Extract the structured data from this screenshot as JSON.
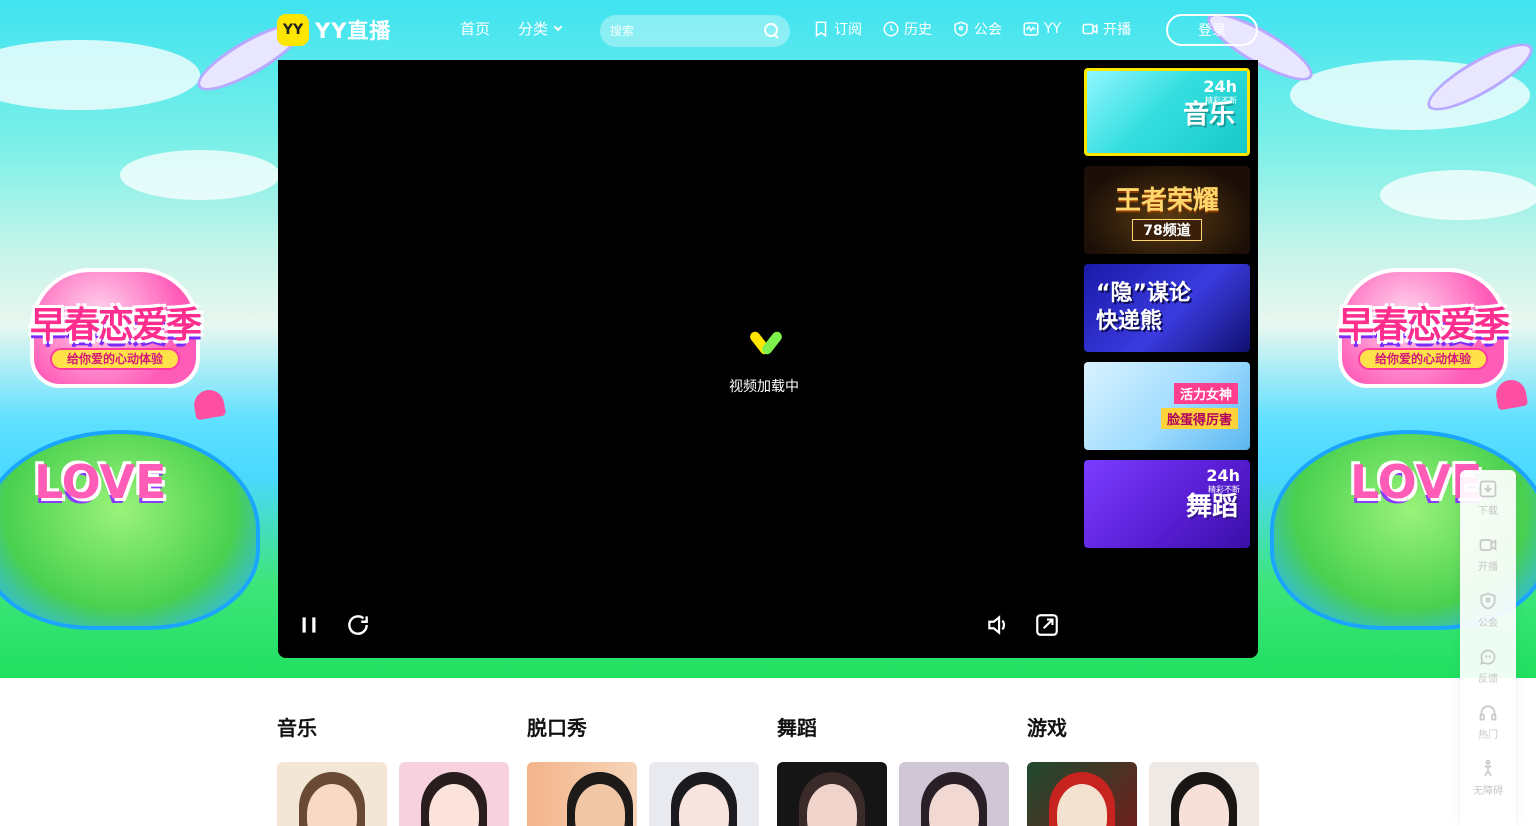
{
  "header": {
    "logo_badge": "YY",
    "logo_text": "YY直播",
    "nav": [
      {
        "label": "首页"
      },
      {
        "label": "分类"
      }
    ],
    "search": {
      "placeholder": "搜索"
    },
    "tools": [
      {
        "label": "订阅",
        "icon": "bookmark-icon"
      },
      {
        "label": "历史",
        "icon": "clock-icon"
      },
      {
        "label": "公会",
        "icon": "shield-icon"
      },
      {
        "label": "YY",
        "icon": "pulse-icon"
      },
      {
        "label": "开播",
        "icon": "camera-icon"
      }
    ],
    "login_label": "登录"
  },
  "hero": {
    "poster_title": "早春恋爱季",
    "poster_ribbon": "给你爱的心动体验",
    "love_word": "LOVE"
  },
  "player": {
    "loading_text": "视频加载中",
    "controls": [
      "pause-icon",
      "refresh-icon",
      "volume-icon",
      "popout-icon"
    ]
  },
  "channels": [
    {
      "label": "音乐",
      "badge": "24h",
      "sub": "精彩不断",
      "active": true
    },
    {
      "label": "王者荣耀",
      "num": "78频道"
    },
    {
      "label_line1": "“隐”谋论",
      "label_line2": "快递熊"
    },
    {
      "tag1": "活力女神",
      "tag2": "脸蛋得厉害"
    },
    {
      "label": "舞蹈",
      "badge": "24h",
      "sub": "精彩不断"
    }
  ],
  "float_bar": [
    {
      "label": "下载",
      "icon": "download-icon"
    },
    {
      "label": "开播",
      "icon": "camera-icon"
    },
    {
      "label": "公会",
      "icon": "shield-icon"
    },
    {
      "label": "反馈",
      "icon": "chat-icon"
    },
    {
      "label": "热门",
      "icon": "headset-icon"
    },
    {
      "label": "无障碍",
      "icon": "accessibility-icon"
    }
  ],
  "categories": [
    {
      "title": "音乐"
    },
    {
      "title": "脱口秀"
    },
    {
      "title": "舞蹈"
    },
    {
      "title": "游戏"
    }
  ],
  "colors": {
    "brand_yellow": "#ffe600",
    "player_bg": "#000000",
    "active_border": "#ffe600"
  }
}
